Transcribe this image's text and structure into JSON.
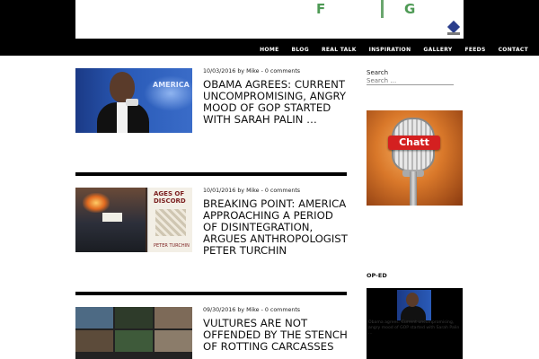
{
  "header": {
    "banner_letters": [
      "F",
      "G"
    ],
    "nav": [
      "HOME",
      "BLOG",
      "REAL TALK",
      "INSPIRATION",
      "GALLERY",
      "FEEDS",
      "CONTACT"
    ]
  },
  "posts": [
    {
      "date": "10/03/2016",
      "by": "by",
      "author": "Mike",
      "sep": "-",
      "comments": "0 comments",
      "title": "OBAMA AGREES: CURRENT UNCOMPROMISING, ANGRY MOOD OF GOP STARTED WITH SARAH PALIN …",
      "thumb_text": "AMERICA"
    },
    {
      "date": "10/01/2016",
      "by": "by",
      "author": "Mike",
      "sep": "-",
      "comments": "0 comments",
      "title": "BREAKING POINT: AMERICA APPROACHING A PERIOD OF DISINTEGRATION, ARGUES ANTHROPOLOGIST PETER TURCHIN",
      "book_title": "AGES OF DISCORD",
      "book_author": "PETER TURCHIN"
    },
    {
      "date": "09/30/2016",
      "by": "by",
      "author": "Mike",
      "sep": "-",
      "comments": "0 comments",
      "title": "VULTURES ARE NOT OFFENDED BY THE STENCH OF ROTTING CARCASSES"
    }
  ],
  "sidebar": {
    "search_label": "Search",
    "search_placeholder": "Search …",
    "ad_text": "Chatt",
    "op_ed_label": "OP-ED",
    "op_ed_text": "Obama agrees: Current uncompromising, angry mood of GOP started with Sarah Palin …"
  },
  "colors": {
    "background": "#ffffff",
    "header_band": "#000000",
    "divider": "#000000",
    "banner_green": "#4e9a55",
    "ad_badge_red": "#d42020"
  }
}
